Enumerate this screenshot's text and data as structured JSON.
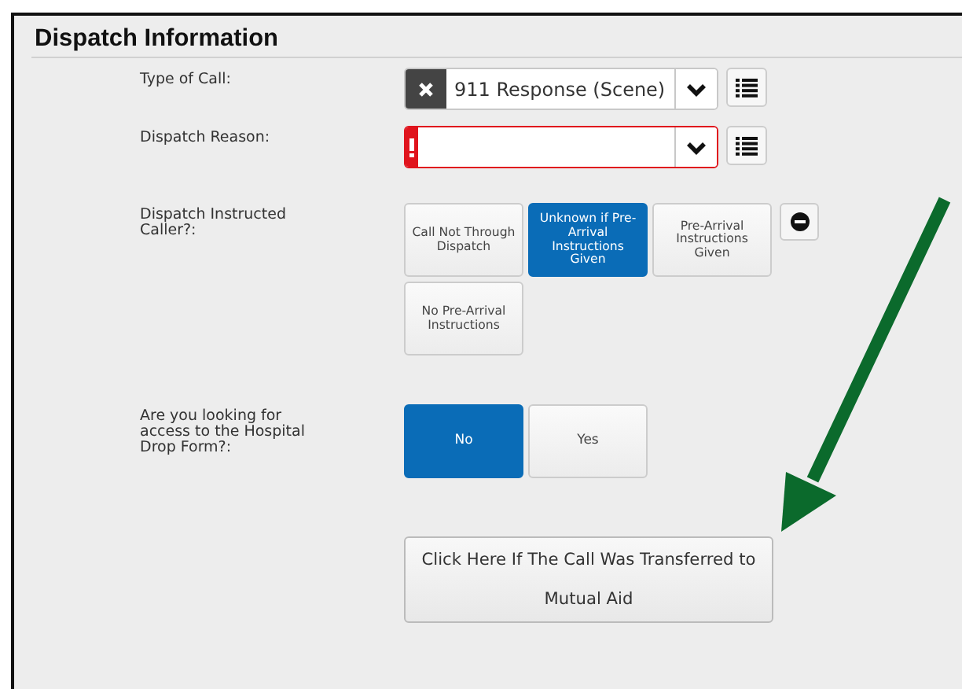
{
  "section": {
    "title": "Dispatch Information"
  },
  "fields": [
    {
      "kind": "select",
      "label": "Type of Call:",
      "value": "911 Response (Scene)",
      "clearable": true,
      "error": false
    },
    {
      "kind": "select",
      "label": "Dispatch Reason:",
      "clearable": false,
      "error": true
    },
    {
      "kind": "choices",
      "label": "Dispatch Instructed Caller?:",
      "clear_button": true,
      "options": [
        {
          "label": "Call Not Through Dispatch",
          "selected": false
        },
        {
          "label": "Unknown if Pre-Arrival Instructions Given",
          "selected": true
        },
        {
          "label": "Pre-Arrival Instructions Given",
          "selected": false
        },
        {
          "label": "No Pre-Arrival Instructions",
          "selected": false
        }
      ]
    },
    {
      "kind": "choices",
      "label": "Are you looking for access to the Hospital Drop Form?:",
      "clear_button": false,
      "options": [
        {
          "label": "No",
          "selected": true
        },
        {
          "label": "Yes",
          "selected": false
        }
      ]
    },
    {
      "kind": "action",
      "label": "Click Here If The Call Was Transferred to Mutual Aid"
    }
  ]
}
